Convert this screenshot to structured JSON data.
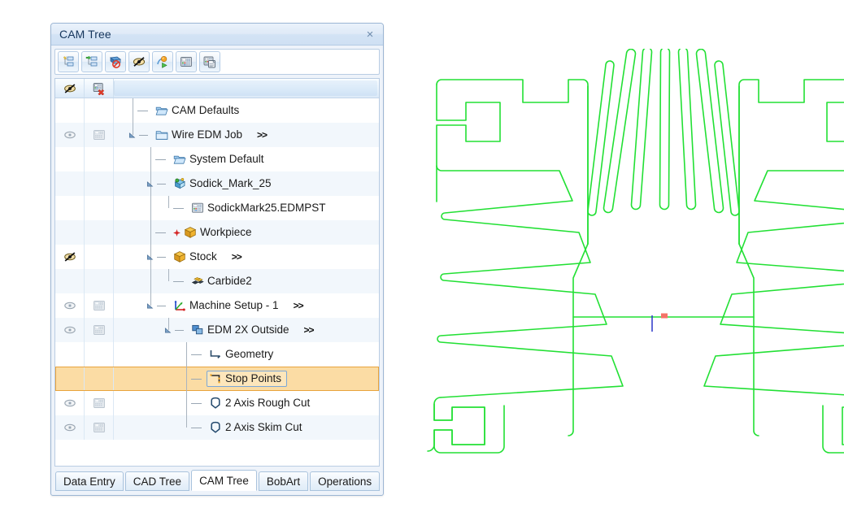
{
  "panel": {
    "title": "CAM Tree",
    "close_label": "×",
    "close_icon": "close-icon"
  },
  "toolbar": {
    "buttons": [
      {
        "name": "new-cam-part-button",
        "icon": "new-tree-node-icon",
        "tip": "New"
      },
      {
        "name": "add-machining-op-button",
        "icon": "add-tree-node-icon",
        "tip": "Add"
      },
      {
        "name": "delete-toolpath-button",
        "icon": "delete-toolpath-icon",
        "tip": "Delete"
      },
      {
        "name": "toggle-visibility-button",
        "icon": "hidden-eye-icon",
        "tip": "Hide"
      },
      {
        "name": "simulate-button",
        "icon": "simulate-play-icon",
        "tip": "Simulate"
      },
      {
        "name": "posting-button",
        "icon": "post-grid-icon",
        "tip": "Post"
      },
      {
        "name": "report-button",
        "icon": "report-grid-icon",
        "tip": "Report"
      }
    ]
  },
  "tree_header": {
    "col_visibility_icon": "hidden-eye-icon",
    "col_toolpath_icon": "delete-grid-icon"
  },
  "tree": {
    "rows": [
      {
        "label": "CAM Defaults",
        "icon": "folder-open-icon",
        "depth": 1,
        "expander": "none",
        "connector": "tee",
        "eye": "none",
        "grid": "none",
        "suffix": "",
        "selected": false
      },
      {
        "label": "Wire EDM Job",
        "icon": "folder-closed-icon",
        "depth": 1,
        "expander": "expanded",
        "connector": "tee",
        "eye": "visible",
        "grid": "grid",
        "suffix": ">>",
        "selected": false
      },
      {
        "label": "System Default",
        "icon": "folder-open-icon",
        "depth": 2,
        "expander": "none",
        "connector": "tee",
        "eye": "none",
        "grid": "none",
        "suffix": "",
        "selected": false
      },
      {
        "label": "Sodick_Mark_25",
        "icon": "machine-icon",
        "depth": 2,
        "expander": "expanded",
        "connector": "tee",
        "eye": "none",
        "grid": "none",
        "suffix": "",
        "selected": false
      },
      {
        "label": "SodickMark25.EDMPST",
        "icon": "post-grid-icon",
        "depth": 3,
        "expander": "none",
        "connector": "dash",
        "eye": "none",
        "grid": "none",
        "suffix": "",
        "selected": false
      },
      {
        "label": "Workpiece",
        "icon": "box-icon",
        "depth": 2,
        "expander": "none",
        "connector": "dash-star",
        "eye": "none",
        "grid": "none",
        "suffix": "",
        "selected": false
      },
      {
        "label": "Stock",
        "icon": "box-icon",
        "depth": 2,
        "expander": "expanded",
        "connector": "tee",
        "eye": "hidden",
        "grid": "none",
        "suffix": ">>",
        "selected": false
      },
      {
        "label": "Carbide2",
        "icon": "material-icon",
        "depth": 3,
        "expander": "none",
        "connector": "dash",
        "eye": "none",
        "grid": "none",
        "suffix": "",
        "selected": false
      },
      {
        "label": "Machine Setup - 1",
        "icon": "axis-icon",
        "depth": 2,
        "expander": "expanded",
        "connector": "tee",
        "eye": "visible",
        "grid": "grid",
        "suffix": ">>",
        "selected": false
      },
      {
        "label": "EDM 2X Outside",
        "icon": "edm-shapes-icon",
        "depth": 3,
        "expander": "expanded",
        "connector": "tee",
        "eye": "visible",
        "grid": "grid",
        "suffix": ">>",
        "selected": false
      },
      {
        "label": "Geometry",
        "icon": "geometry-icon",
        "depth": 4,
        "expander": "none",
        "connector": "tee",
        "eye": "none",
        "grid": "none",
        "suffix": "",
        "selected": false
      },
      {
        "label": "Stop Points",
        "icon": "stop-points-icon",
        "depth": 4,
        "expander": "none",
        "connector": "tee",
        "eye": "none",
        "grid": "none",
        "suffix": "",
        "selected": true
      },
      {
        "label": "2 Axis Rough Cut",
        "icon": "cut-icon",
        "depth": 4,
        "expander": "none",
        "connector": "tee",
        "eye": "visible",
        "grid": "grid",
        "suffix": "",
        "selected": false
      },
      {
        "label": "2 Axis Skim Cut",
        "icon": "cut-icon",
        "depth": 4,
        "expander": "none",
        "connector": "ell",
        "eye": "visible",
        "grid": "grid",
        "suffix": "",
        "selected": false
      }
    ]
  },
  "tabs": {
    "items": [
      {
        "label": "Data Entry",
        "active": false
      },
      {
        "label": "CAD Tree",
        "active": false
      },
      {
        "label": "CAM Tree",
        "active": true
      },
      {
        "label": "BobArt",
        "active": false
      },
      {
        "label": "Operations",
        "active": false
      }
    ]
  },
  "cad_view": {
    "geometry_color": "#22e034",
    "stop_point_color": "#f47368",
    "lead_line_color": "#2b36c8",
    "part_name": "heatsink-profile-wireframe",
    "stop_point_marker": "stop-point-marker",
    "lead_in_line": "lead-in-line"
  }
}
